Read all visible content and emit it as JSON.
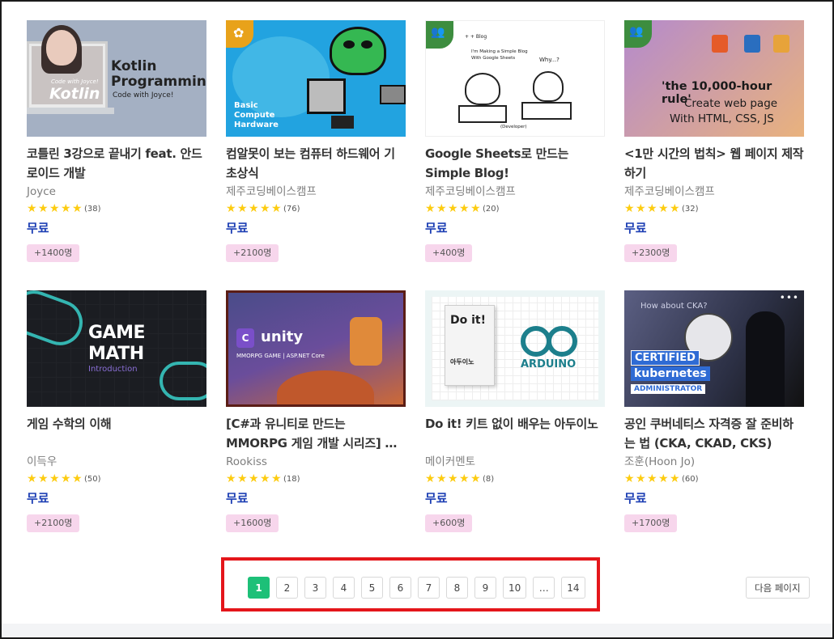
{
  "courses": [
    {
      "title": "코틀린 3강으로 끝내기 feat. 안드로이드 개발",
      "instructor": "Joyce",
      "rating_count": "(38)",
      "rating": 5,
      "price": "무료",
      "students": "+1400명",
      "thumb_text": {
        "big": "Kotlin",
        "code_with": "Code with Joyce!",
        "kp": "Kotlin Programming",
        "sub": "Code with Joyce!"
      }
    },
    {
      "title": "컴알못이 보는 컴퓨터 하드웨어 기초상식",
      "instructor": "제주코딩베이스캠프",
      "rating_count": "(76)",
      "rating": 5,
      "price": "무료",
      "students": "+2100명",
      "thumb_text": {
        "t1": "Basic",
        "t2": "Compute",
        "t3": "Hardware"
      }
    },
    {
      "title": "Google Sheets로 만드는 Simple Blog!",
      "instructor": "제주코딩베이스캠프",
      "rating_count": "(20)",
      "rating": 5,
      "price": "무료",
      "students": "+400명",
      "thumb_text": {
        "hdr": "+ + Blog",
        "sub": "I'm Making a Simple Blog With Google Sheets",
        "why": "Why...?",
        "dev": "(Developer)"
      }
    },
    {
      "title": "<1만 시간의 법칙> 웹 페이지 제작하기",
      "instructor": "제주코딩베이스캠프",
      "rating_count": "(32)",
      "rating": 5,
      "price": "무료",
      "students": "+2300명",
      "thumb_text": {
        "l1": "'the 10,000-hour rule'",
        "l2": "Create web page",
        "l3": "With HTML, CSS, JS"
      }
    },
    {
      "title": "게임 수학의 이해",
      "instructor": "이득우",
      "rating_count": "(50)",
      "rating": 5,
      "price": "무료",
      "students": "+2100명",
      "thumb_text": {
        "gm1": "GAME",
        "gm2": "MATH",
        "intro": "Introduction"
      }
    },
    {
      "title": "[C#과 유니티로 만드는 MMORPG 게임 개발 시리즈] …",
      "instructor": "Rookiss",
      "rating_count": "(18)",
      "rating": 5,
      "price": "무료",
      "students": "+1600명",
      "thumb_text": {
        "c": "C",
        "unity": "unity",
        "mmo": "MMORPG GAME | ASP.NET Core"
      }
    },
    {
      "title": "Do it! 키트 없이 배우는 아두이노",
      "instructor": "메이커멘토",
      "rating_count": "(8)",
      "rating": 5,
      "price": "무료",
      "students": "+600명",
      "thumb_text": {
        "doit": "Do it!",
        "ko": "아두이노",
        "ard": "ARDUINO"
      }
    },
    {
      "title": "공인 쿠버네티스 자격증 잘 준비하는 법 (CKA, CKAD, CKS)",
      "instructor": "조훈(Hoon Jo)",
      "rating_count": "(60)",
      "rating": 5,
      "price": "무료",
      "students": "+1700명",
      "thumb_text": {
        "hac": "How about CKA?",
        "c1": "CERTIFIED",
        "c2": "kubernetes",
        "c3": "ADMINISTRATOR"
      }
    }
  ],
  "pagination": {
    "pages": [
      "1",
      "2",
      "3",
      "4",
      "5",
      "6",
      "7",
      "8",
      "9",
      "10",
      "…",
      "14"
    ],
    "active": "1",
    "next_label": "다음 페이지"
  },
  "colors": {
    "active_page": "#1dc078",
    "price": "#1d3fb4",
    "badge_bg": "#f7d6ec",
    "star": "#fdcc11",
    "highlight_box": "#e4161b"
  },
  "icons": {
    "star": "star-icon",
    "leaf_badge": "leaf-icon",
    "people_badge": "people-icon"
  }
}
